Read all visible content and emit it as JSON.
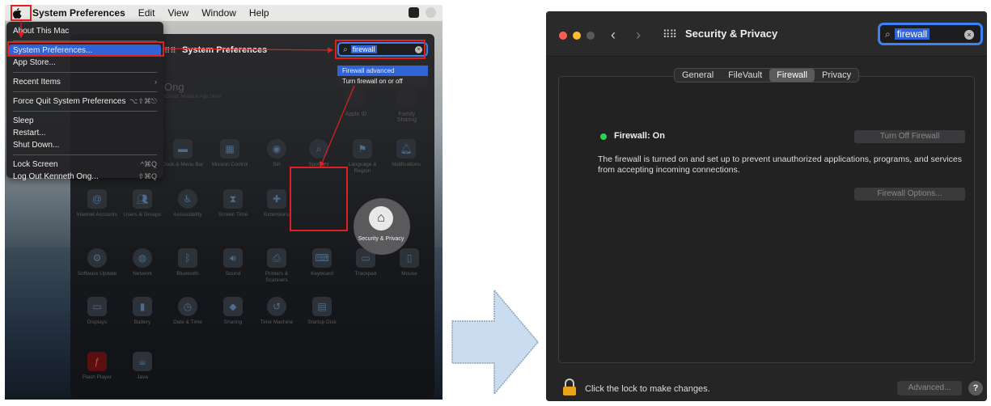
{
  "left": {
    "menubar": {
      "apple_glyph": "",
      "items": [
        "System Preferences",
        "Edit",
        "View",
        "Window",
        "Help"
      ]
    },
    "apple_menu": {
      "items": [
        {
          "label": "About This Mac",
          "shortcut": ""
        },
        {
          "label": "System Preferences...",
          "shortcut": ""
        },
        {
          "label": "App Store...",
          "shortcut": ""
        },
        {
          "label": "Recent Items",
          "shortcut": "›"
        },
        {
          "label": "Force Quit System Preferences",
          "shortcut": "⌥⇧⌘⎋"
        },
        {
          "label": "Sleep",
          "shortcut": ""
        },
        {
          "label": "Restart...",
          "shortcut": ""
        },
        {
          "label": "Shut Down...",
          "shortcut": ""
        },
        {
          "label": "Lock Screen",
          "shortcut": "^⌘Q"
        },
        {
          "label": "Log Out Kenneth Ong...",
          "shortcut": "⇧⌘Q"
        }
      ]
    },
    "sp_window": {
      "title": "System Preferences",
      "search_value": "firewall",
      "search_results": [
        "Firewall advanced",
        "Turn firewall on or off"
      ],
      "user_name": "Ong",
      "user_sub": "iCloud, Media & App Store",
      "top_prefs": [
        "Apple ID",
        "Family Sharing"
      ],
      "row1": [
        "Dock & Menu Bar",
        "Mission Control",
        "Siri",
        "Spotlight",
        "Language & Region",
        "Notifications"
      ],
      "row2": [
        "Internet Accounts",
        "Users & Groups",
        "Accessibility",
        "Screen Time",
        "Extensions"
      ],
      "security": "Security & Privacy",
      "row3": [
        "Software Update",
        "Network",
        "Bluetooth",
        "Sound",
        "Printers & Scanners",
        "Keyboard",
        "Trackpad",
        "Mouse"
      ],
      "row4": [
        "Displays",
        "Battery",
        "Date & Time",
        "Sharing",
        "Time Machine",
        "Startup Disk"
      ],
      "row5": [
        "Flash Player",
        "Java"
      ]
    }
  },
  "right": {
    "title": "Security & Privacy",
    "search_value": "firewall",
    "tabs": [
      "General",
      "FileVault",
      "Firewall",
      "Privacy"
    ],
    "firewall_status": "Firewall: On",
    "turn_off_button": "Turn Off Firewall",
    "description": "The firewall is turned on and set up to prevent unauthorized applications, programs, and services from accepting incoming connections.",
    "options_button": "Firewall Options...",
    "lock_text": "Click the lock to make changes.",
    "advanced_button": "Advanced...",
    "help_button": "?"
  },
  "colors": {
    "accent": "#2f63d6",
    "highlight_box": "#e02020",
    "status_on": "#2fd158",
    "arrow_fill": "#c9dcf0"
  }
}
